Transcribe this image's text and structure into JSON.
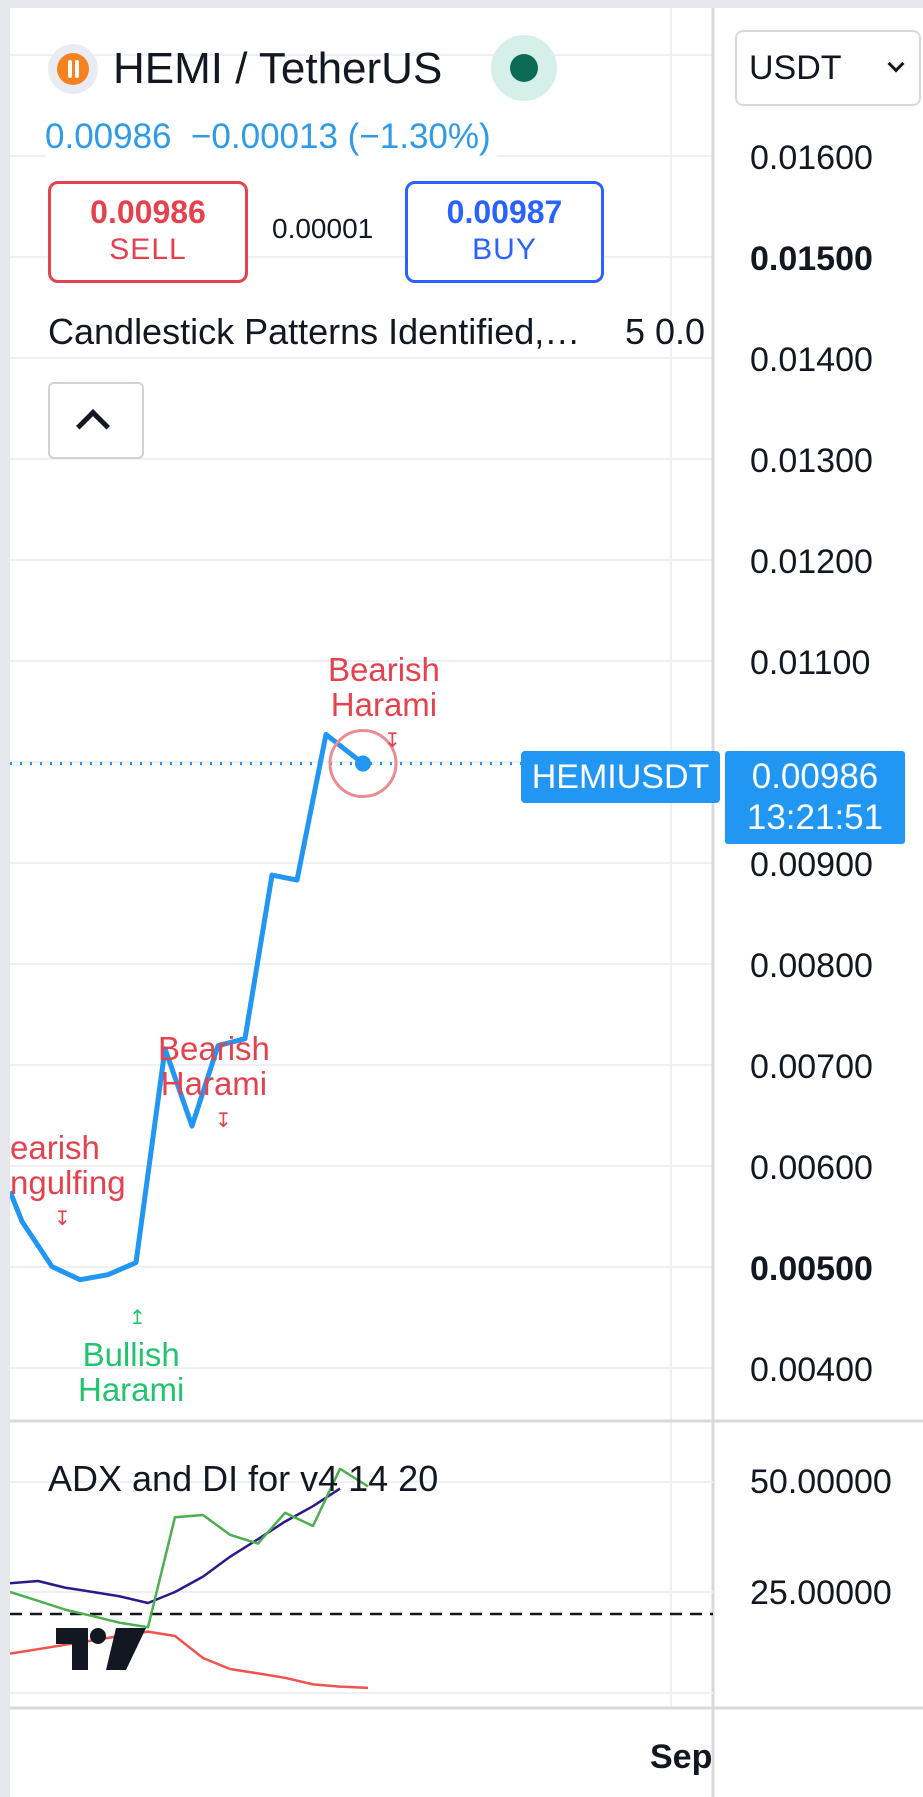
{
  "header": {
    "symbol_title": "HEMI / TetherUS",
    "last_price": "0.00986",
    "change": "−0.00013 (−1.30%)",
    "sell_price": "0.00986",
    "sell_label": "SELL",
    "buy_price": "0.00987",
    "buy_label": "BUY",
    "spread": "0.00001",
    "currency": "USDT"
  },
  "indicator": {
    "name": "Candlestick Patterns Identified,…",
    "values": "5 0.0"
  },
  "price_axis": {
    "labels": [
      "0.01600",
      "0.01500",
      "0.01400",
      "0.01300",
      "0.01200",
      "0.01100",
      "0.00900",
      "0.00800",
      "0.00700",
      "0.00600",
      "0.00500",
      "0.00400"
    ],
    "bold_labels": [
      "0.01500",
      "0.00500"
    ]
  },
  "price_tag": {
    "symbol": "HEMIUSDT",
    "price": "0.00986",
    "countdown": "13:21:51"
  },
  "patterns": [
    {
      "text": "Bearish\nHarami",
      "kind": "bearish"
    },
    {
      "text": "Bearish\nHarami",
      "kind": "bearish"
    },
    {
      "text": "earish\nngulfing",
      "kind": "bearish"
    },
    {
      "text": "Bullish\nHarami",
      "kind": "bullish"
    }
  ],
  "adx": {
    "title": "ADX and DI for v4 14 20",
    "labels": [
      "50.00000",
      "25.00000"
    ]
  },
  "time_axis": {
    "label": "Sep"
  },
  "colors": {
    "accent": "#2196f3",
    "sell": "#e5424f",
    "buy": "#2962ff",
    "bullish": "#22c46f",
    "adx_line": "#2b1a8c",
    "di_plus": "#4caf50",
    "di_minus": "#ef5350"
  },
  "chart_data": [
    {
      "type": "line",
      "ylim": [
        0.0035,
        0.0165
      ],
      "x": [
        0,
        1,
        2,
        3,
        4,
        5,
        6,
        7,
        8,
        9,
        10,
        11,
        12,
        13,
        14,
        15
      ],
      "values": [
        0.0056,
        0.0053,
        0.00485,
        0.00472,
        0.00477,
        0.00489,
        0.00702,
        0.00625,
        0.00705,
        0.00712,
        0.00875,
        0.0087,
        0.01015,
        0.00986
      ]
    },
    {
      "type": "line",
      "ylim": [
        0,
        70
      ],
      "series": [
        {
          "values": [
            27,
            27.5,
            26,
            25,
            24,
            22.5,
            25,
            28.5,
            33,
            37,
            41,
            44.5,
            48.5
          ]
        },
        {
          "values": [
            25,
            23,
            21,
            19.5,
            18,
            17,
            42,
            42.5,
            38,
            36,
            43,
            40,
            53,
            49
          ]
        },
        {
          "values": [
            11,
            12,
            13,
            14,
            15,
            16,
            15,
            10,
            7.5,
            6.5,
            5.5,
            4,
            3.5,
            3.2
          ]
        }
      ]
    }
  ]
}
